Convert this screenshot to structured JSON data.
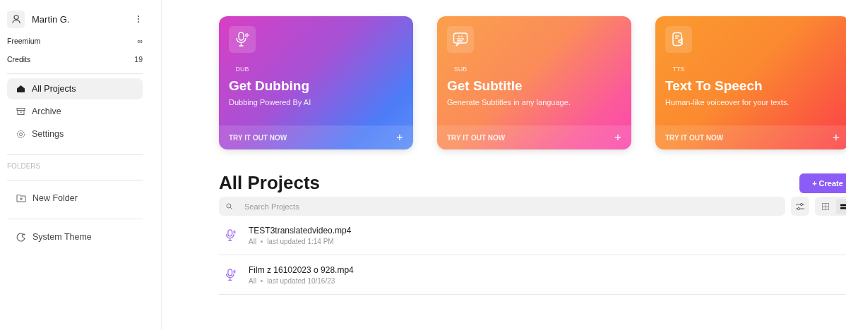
{
  "sidebar": {
    "user": {
      "name": "Martin G."
    },
    "plan": [
      {
        "label": "Freemium",
        "value": "∞"
      },
      {
        "label": "Credits",
        "value": "19"
      }
    ],
    "nav": [
      {
        "label": "All Projects",
        "selected": true
      },
      {
        "label": "Archive",
        "selected": false
      },
      {
        "label": "Settings",
        "selected": false
      }
    ],
    "folders_heading": "FOLDERS",
    "new_folder": "New Folder",
    "theme": "System Theme"
  },
  "cards": [
    {
      "kind": "dub",
      "tag": "DUB",
      "title": "Get Dubbing",
      "subtitle": "Dubbing Powered By AI",
      "action": "TRY IT OUT NOW",
      "plus": "+"
    },
    {
      "kind": "sub",
      "tag": "SUB",
      "title": "Get Subtitle",
      "subtitle": "Generate Subtitles in any language.",
      "action": "TRY IT OUT NOW",
      "plus": "+"
    },
    {
      "kind": "tts",
      "tag": "TTS",
      "title": "Text To Speech",
      "subtitle": "Human-like voiceover for your texts.",
      "action": "TRY IT OUT NOW",
      "plus": "+"
    }
  ],
  "projects": {
    "title": "All Projects",
    "create": "+ Create",
    "search": {
      "placeholder": "Search Projects"
    },
    "views": [
      {
        "kind": "grid",
        "selected": false
      },
      {
        "kind": "list",
        "selected": true
      }
    ],
    "rows": [
      {
        "name": "TEST3translatedvideo.mp4",
        "folder": "All",
        "updated": "last updated 1:14 PM"
      },
      {
        "name": "Film z 16102023 o 928.mp4",
        "folder": "All",
        "updated": "last updated 10/16/23"
      }
    ]
  }
}
